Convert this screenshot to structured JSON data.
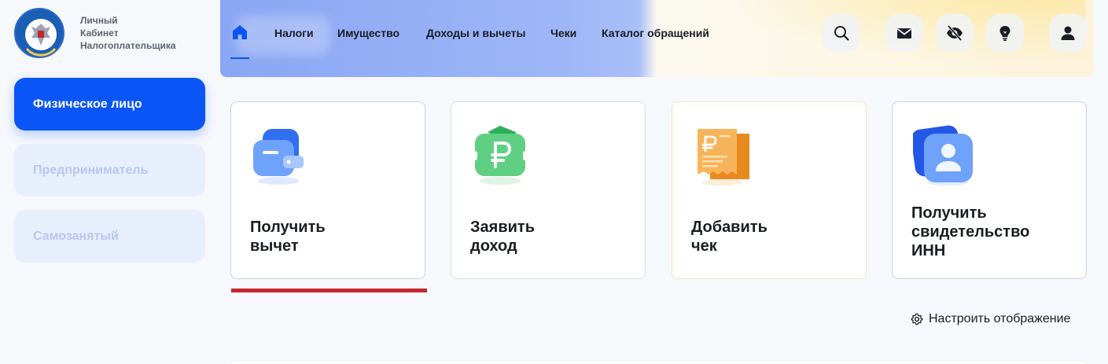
{
  "brand": {
    "logo_lines": [
      "Личный",
      "Кабинет",
      "Налогоплательщика"
    ],
    "emblem_icon": "fns-emblem-icon"
  },
  "roles": [
    {
      "label": "Физическое лицо",
      "active": true
    },
    {
      "label": "Предприниматель",
      "active": false
    },
    {
      "label": "Самозанятый",
      "active": false
    }
  ],
  "nav": {
    "home_icon": "home-icon",
    "items": [
      "Налоги",
      "Имущество",
      "Доходы и вычеты",
      "Чеки",
      "Каталог обращений"
    ]
  },
  "header_icons": [
    "search-icon",
    "mail-icon",
    "eye-off-icon",
    "lightbulb-icon",
    "user-icon"
  ],
  "cards": [
    {
      "title_lines": [
        "Получить",
        "вычет"
      ],
      "icon": "wallet-icon",
      "accent": "#2f7cf6"
    },
    {
      "title_lines": [
        "Заявить",
        "доход"
      ],
      "icon": "ruble-icon",
      "accent": "#3fbf6a"
    },
    {
      "title_lines": [
        "Добавить",
        "чек"
      ],
      "icon": "receipt-icon",
      "accent": "#f5a43a"
    },
    {
      "title_lines": [
        "Получить",
        "свидетельство",
        "ИНН"
      ],
      "icon": "id-card-icon",
      "accent": "#2f7cf6"
    }
  ],
  "settings": {
    "label": "Настроить отображение",
    "icon": "gear-icon"
  },
  "colors": {
    "primary": "#0a55f5",
    "active_underline": "#c3262b",
    "inactive_role_bg": "#e7eefc",
    "inactive_role_text": "#b7c8ef"
  }
}
